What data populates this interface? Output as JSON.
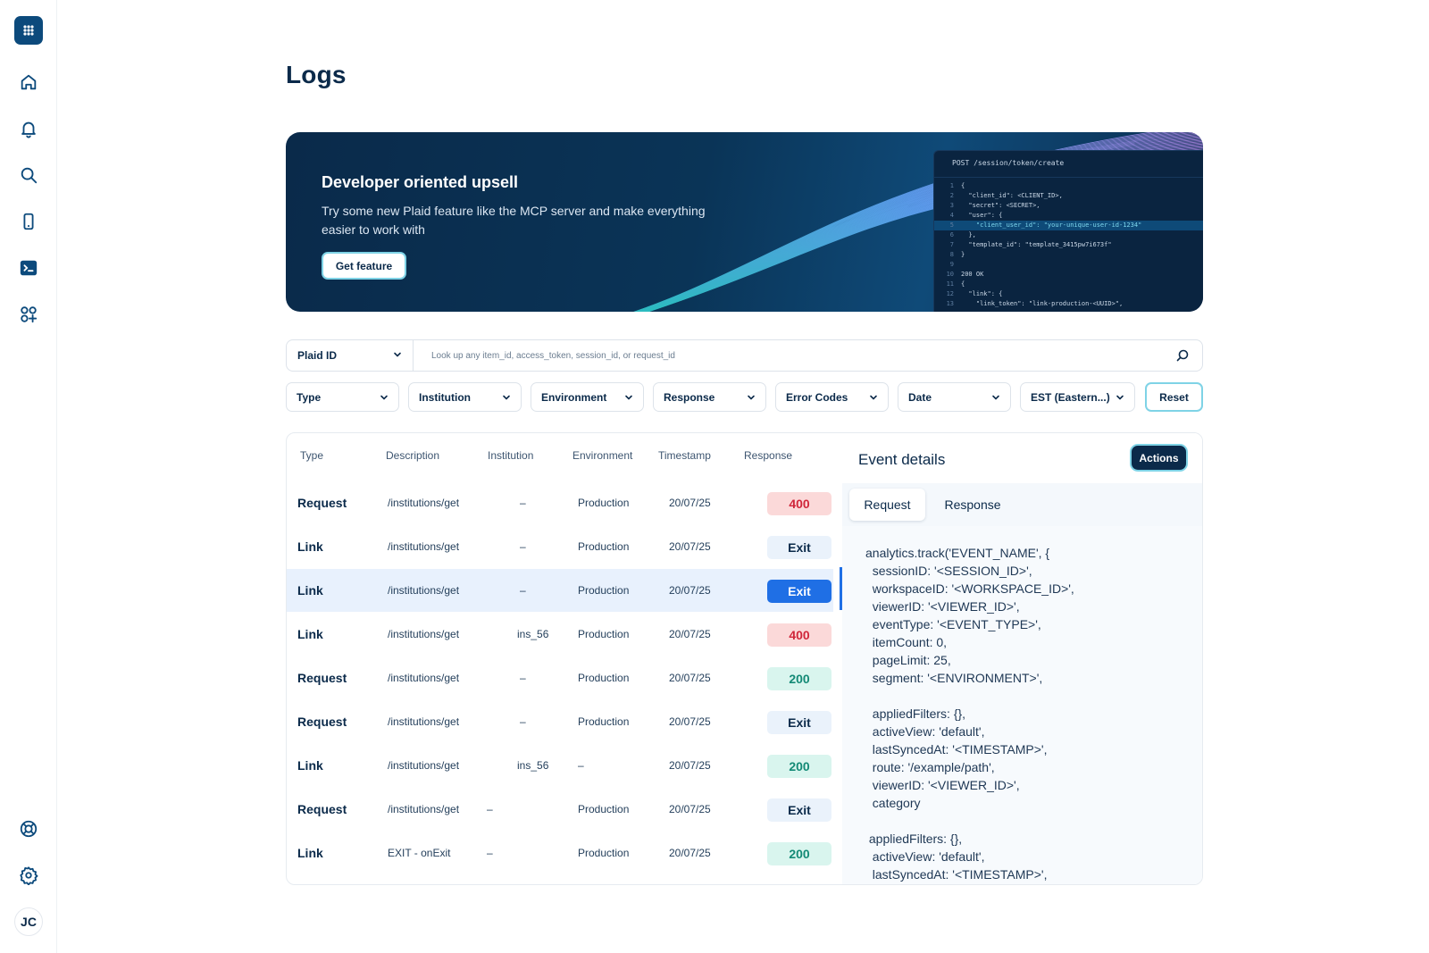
{
  "sidebar": {
    "logo_icon": "plaid-logo-icon",
    "items": [
      {
        "name": "home",
        "icon": "home-icon"
      },
      {
        "name": "notifications",
        "icon": "bell-icon"
      },
      {
        "name": "search",
        "icon": "search-icon"
      },
      {
        "name": "mobile",
        "icon": "phone-icon"
      },
      {
        "name": "logs",
        "icon": "terminal-icon",
        "active": true
      },
      {
        "name": "apps",
        "icon": "apps-plus-icon"
      }
    ],
    "bottom": [
      {
        "name": "help",
        "icon": "lifebuoy-icon"
      },
      {
        "name": "settings",
        "icon": "gear-icon"
      }
    ],
    "avatar_initials": "JC"
  },
  "page": {
    "title": "Logs"
  },
  "banner": {
    "title": "Developer oriented upsell",
    "text": "Try some new Plaid feature like the MCP server and make everything easier to work with",
    "button_label": "Get feature",
    "code_header": "POST /session/token/create",
    "code_lines": [
      "{",
      "  \"client_id\": <CLIENT_ID>,",
      "  \"secret\": <SECRET>,",
      "  \"user\": {",
      "    \"client_user_id\": \"your-unique-user-id-1234\"",
      "  },",
      "  \"template_id\": \"template_3415pw7i673f\"",
      "}",
      "",
      "200 OK",
      "{",
      "  \"link\": {",
      "    \"link_token\": \"link-production-<UUID>\","
    ],
    "highlight_line": 5
  },
  "search": {
    "select_label": "Plaid ID",
    "placeholder": "Look up any item_id, access_token, session_id, or request_id"
  },
  "filters": [
    "Type",
    "Institution",
    "Environment",
    "Response",
    "Error Codes",
    "Date",
    "EST (Eastern...)"
  ],
  "reset_label": "Reset",
  "table": {
    "columns": [
      "Type",
      "Description",
      "Institution",
      "Environment",
      "Timestamp",
      "Response"
    ],
    "rows": [
      {
        "type": "Request",
        "description": "/institutions/get",
        "institution": "–",
        "environment": "Production",
        "timestamp": "20/07/25",
        "response": "400",
        "status": "err"
      },
      {
        "type": "Link",
        "description": "/institutions/get",
        "institution": "–",
        "environment": "Production",
        "timestamp": "20/07/25",
        "response": "Exit",
        "status": "exit"
      },
      {
        "type": "Link",
        "description": "/institutions/get",
        "institution": "–",
        "environment": "Production",
        "timestamp": "20/07/25",
        "response": "Exit",
        "status": "exit-sel",
        "selected": true
      },
      {
        "type": "Link",
        "description": "/institutions/get",
        "institution": "ins_56",
        "environment": "Production",
        "timestamp": "20/07/25",
        "response": "400",
        "status": "err"
      },
      {
        "type": "Request",
        "description": "/institutions/get",
        "institution": "–",
        "environment": "Production",
        "timestamp": "20/07/25",
        "response": "200",
        "status": "ok"
      },
      {
        "type": "Request",
        "description": "/institutions/get",
        "institution": "–",
        "environment": "Production",
        "timestamp": "20/07/25",
        "response": "Exit",
        "status": "exit"
      },
      {
        "type": "Link",
        "description": "/institutions/get",
        "institution": "ins_56",
        "environment": "–",
        "timestamp": "20/07/25",
        "response": "200",
        "status": "ok"
      },
      {
        "type": "Request",
        "description": "/institutions/get",
        "institution": "–",
        "environment": "Production",
        "timestamp": "20/07/25",
        "response": "Exit",
        "status": "exit"
      },
      {
        "type": "Link",
        "description": "EXIT - onExit",
        "institution": "–",
        "environment": "Production",
        "timestamp": "20/07/25",
        "response": "200",
        "status": "ok"
      }
    ]
  },
  "details": {
    "title": "Event details",
    "actions_label": "Actions",
    "tabs": [
      "Request",
      "Response"
    ],
    "code": "analytics.track('EVENT_NAME', {\n  sessionID: '<SESSION_ID>',\n  workspaceID: '<WORKSPACE_ID>',\n  viewerID: '<VIEWER_ID>',\n  eventType: '<EVENT_TYPE>',\n  itemCount: 0,\n  pageLimit: 25,\n  segment: '<ENVIRONMENT>',\n\n  appliedFilters: {},\n  activeView: 'default',\n  lastSyncedAt: '<TIMESTAMP>',\n  route: '/example/path',\n  viewerID: '<VIEWER_ID>',\n  category\n\n appliedFilters: {},\n  activeView: 'default',\n  lastSyncedAt: '<TIMESTAMP>',"
  },
  "colors": {
    "brand": "#0b2a4a",
    "accent_blue": "#1f6fe5",
    "accent_teal": "#7fd3e6",
    "error_bg": "#fbd9d9",
    "error_text": "#d0263a",
    "ok_bg": "#d9f5ee",
    "ok_text": "#138a76"
  }
}
